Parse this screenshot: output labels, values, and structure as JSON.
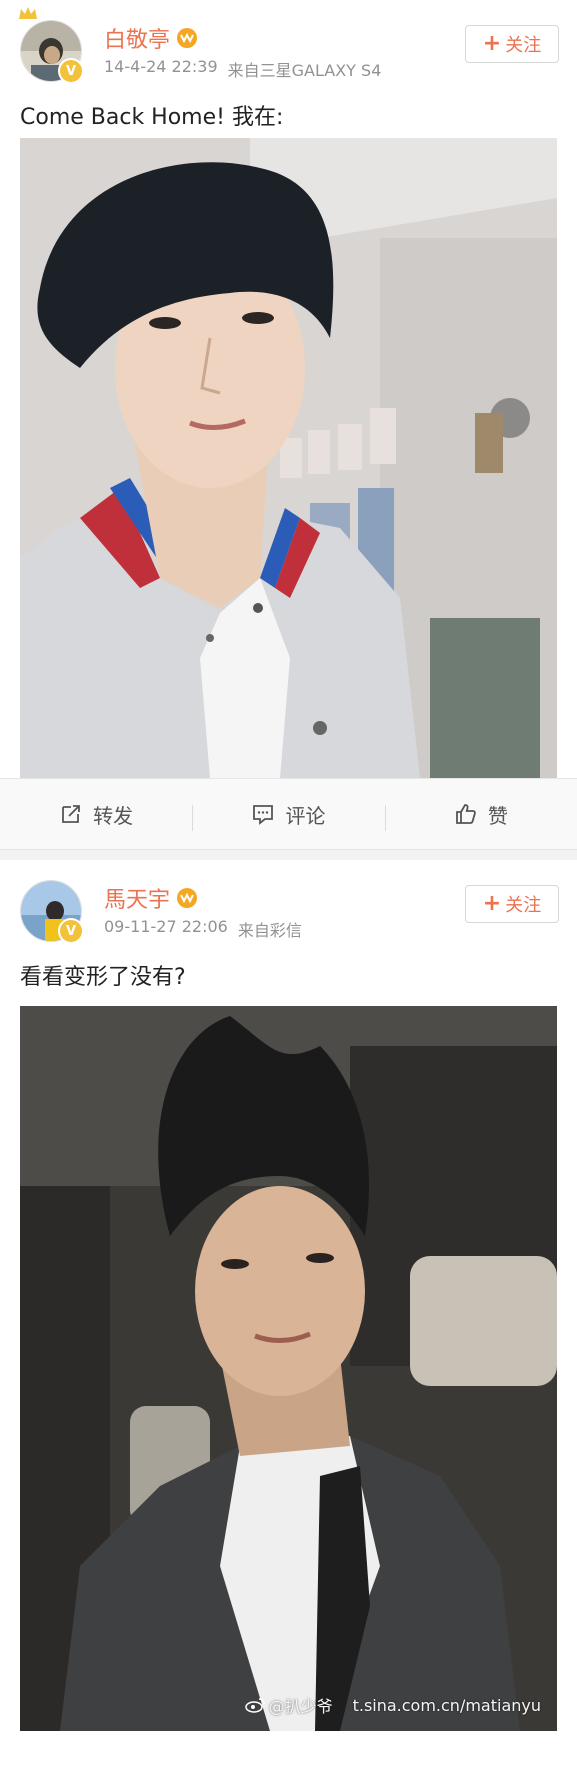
{
  "posts": [
    {
      "username": "白敬亭",
      "timestamp": "14-4-24 22:39",
      "source": "来自三星GALAXY S4",
      "follow_label": "关注",
      "text": "Come Back Home! 我在:",
      "actions": {
        "repost": "转发",
        "comment": "评论",
        "like": "赞"
      }
    },
    {
      "username": "馬天宇",
      "timestamp": "09-11-27 22:06",
      "source": "来自彩信",
      "follow_label": "关注",
      "text": "看看变形了没有?"
    }
  ],
  "watermark": {
    "left": "@扒少爷",
    "right": "t.sina.com.cn/matianyu"
  },
  "colors": {
    "username": "#eb7350",
    "meta": "#929292",
    "verified_badge": "#f3c13a"
  }
}
